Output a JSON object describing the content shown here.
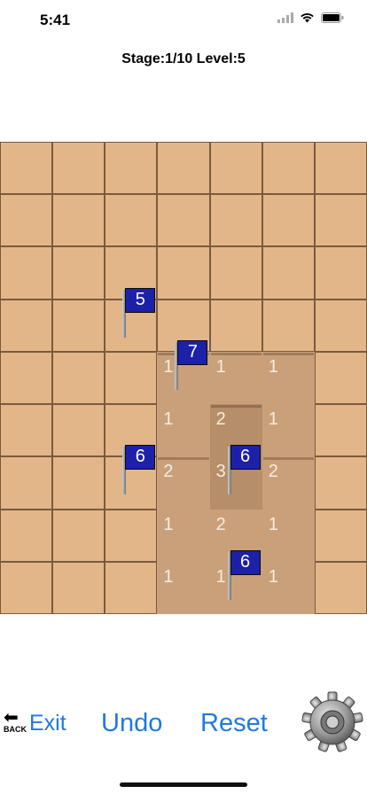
{
  "status_bar": {
    "time": "5:41"
  },
  "header": {
    "stage_level": "Stage:1/10 Level:5"
  },
  "board": {
    "columns": 7,
    "rows": 9,
    "open_cells": [
      {
        "r": 4,
        "c": 3,
        "num": "1"
      },
      {
        "r": 4,
        "c": 4,
        "num": "1"
      },
      {
        "r": 4,
        "c": 5,
        "num": "1"
      },
      {
        "r": 5,
        "c": 3,
        "num": "1"
      },
      {
        "r": 5,
        "c": 4,
        "num": "2"
      },
      {
        "r": 5,
        "c": 5,
        "num": "1"
      },
      {
        "r": 6,
        "c": 3,
        "num": "2"
      },
      {
        "r": 6,
        "c": 4,
        "num": "3"
      },
      {
        "r": 6,
        "c": 5,
        "num": "2"
      },
      {
        "r": 7,
        "c": 3,
        "num": "1"
      },
      {
        "r": 7,
        "c": 4,
        "num": "2"
      },
      {
        "r": 7,
        "c": 5,
        "num": "1"
      },
      {
        "r": 8,
        "c": 3,
        "num": "1"
      },
      {
        "r": 8,
        "c": 4,
        "num": "1"
      },
      {
        "r": 8,
        "c": 5,
        "num": "1"
      }
    ],
    "flags": [
      {
        "r": 3,
        "c": 2,
        "value": "5"
      },
      {
        "r": 4,
        "c": 3,
        "value": "7"
      },
      {
        "r": 6,
        "c": 2,
        "value": "6"
      },
      {
        "r": 6,
        "c": 4,
        "value": "6"
      },
      {
        "r": 8,
        "c": 4,
        "value": "6"
      }
    ]
  },
  "controls": {
    "back_label": "BACK",
    "exit_label": "Exit",
    "undo_label": "Undo",
    "reset_label": "Reset",
    "settings_icon": "gear-icon"
  },
  "colors": {
    "accent": "#1f7ae0",
    "tile": "#e2b689",
    "open_tile": "#c9a07a",
    "flag_banner": "#1d21a8"
  }
}
